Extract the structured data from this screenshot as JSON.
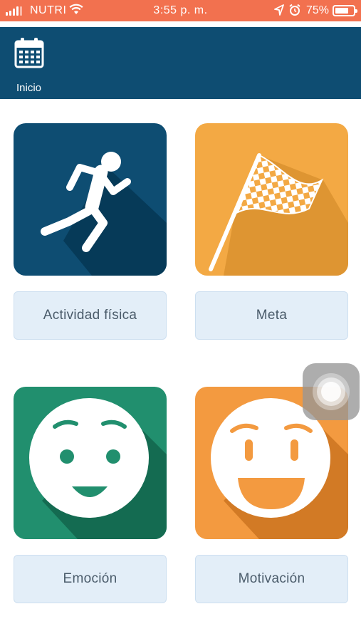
{
  "status_bar": {
    "carrier": "NUTRI",
    "time": "3:55 p. m.",
    "battery": "75%",
    "battery_level": 0.75
  },
  "header": {
    "home_label": "Inicio",
    "icon": "calendar-icon",
    "background": "#0e4d72"
  },
  "cards": [
    {
      "label": "Actividad física",
      "icon": "runner-icon",
      "color": "#0e4d72"
    },
    {
      "label": "Meta",
      "icon": "checkered-flag-icon",
      "color": "#f3a944"
    },
    {
      "label": "Emoción",
      "icon": "smiling-face-icon",
      "color": "#218f6e"
    },
    {
      "label": "Motivación",
      "icon": "grinning-face-icon",
      "color": "#f39a40"
    }
  ]
}
